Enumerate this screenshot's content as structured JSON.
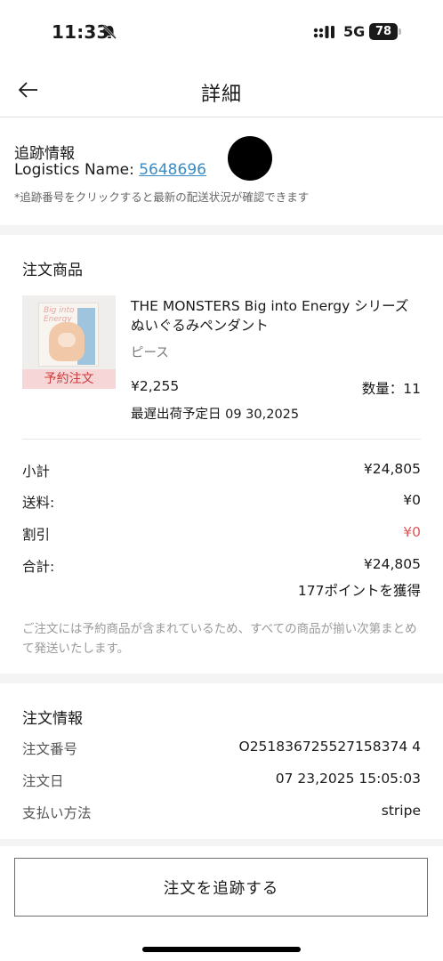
{
  "status_bar": {
    "time": "11:33",
    "network": "5G",
    "battery": "78",
    "icons": [
      "bell-slash-icon",
      "signal-icon",
      "battery-icon"
    ]
  },
  "header": {
    "title": "詳細",
    "back_icon": "arrow-left-icon"
  },
  "tracking": {
    "title": "追跡情報",
    "logistics_label": "Logistics Name: ",
    "tracking_number": "5648696",
    "note": "*追跡番号をクリックすると最新の配送状況が確認できます"
  },
  "order_items": {
    "title": "注文商品",
    "product": {
      "name": "THE MONSTERS Big into Energy シリーズ ぬいぐるみペンダント",
      "variant": "ピース",
      "price": "¥2,255",
      "quantity": "数量：11",
      "ship_date": "最遅出荷予定日 09 30,2025",
      "badge": "予約注文"
    },
    "summary": {
      "subtotal_label": "小計",
      "subtotal_value": "¥24,805",
      "shipping_label": "送料:",
      "shipping_value": "¥0",
      "discount_label": "割引",
      "discount_value": "¥0",
      "total_label": "合計:",
      "total_value": "¥24,805",
      "points": "177ポイントを獲得"
    },
    "note": "ご注文には予約商品が含まれているため、すべての商品が揃い次第まとめて発送いたします。"
  },
  "order_info": {
    "title": "注文情報",
    "order_number_label": "注文番号",
    "order_number": "O251836725527158374 4",
    "order_date_label": "注文日",
    "order_date": "07 23,2025 15:05:03",
    "payment_label": "支払い方法",
    "payment_method": "stripe"
  },
  "footer": {
    "track_button": "注文を追跡する"
  },
  "colors": {
    "link": "#3a8bc4",
    "discount": "#e05555",
    "badge_bg": "#f6d6d6",
    "badge_text": "#cf3a3a",
    "section_gap": "#f4f4f4"
  }
}
